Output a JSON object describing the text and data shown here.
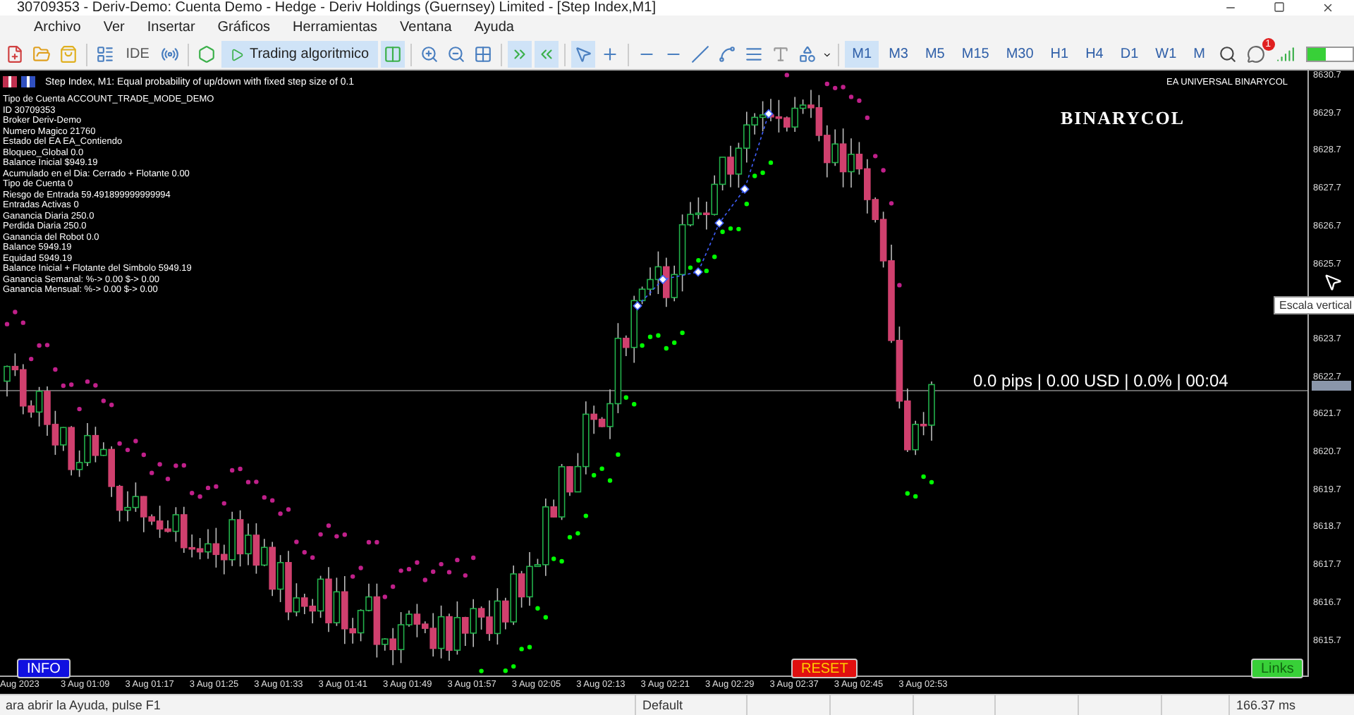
{
  "window": {
    "title": "30709353 - Deriv-Demo: Cuenta Demo - Hedge - Deriv Holdings (Guernsey) Limited - [Step Index,M1]"
  },
  "menu": [
    "Archivo",
    "Ver",
    "Insertar",
    "Gráficos",
    "Herramientas",
    "Ventana",
    "Ayuda"
  ],
  "toolbar": {
    "ide_label": "IDE",
    "algo_button": {
      "label": "Trading algoritmico",
      "on": true
    },
    "timeframes": [
      {
        "label": "M1",
        "selected": true
      },
      {
        "label": "M3",
        "selected": false
      },
      {
        "label": "M5",
        "selected": false
      },
      {
        "label": "M15",
        "selected": false
      },
      {
        "label": "M30",
        "selected": false
      },
      {
        "label": "H1",
        "selected": false
      },
      {
        "label": "H4",
        "selected": false
      },
      {
        "label": "D1",
        "selected": false
      },
      {
        "label": "W1",
        "selected": false
      },
      {
        "label": "M",
        "selected": false
      }
    ],
    "notification_count": "1"
  },
  "chart": {
    "header": "Step Index, M1:  Equal probability of up/down with fixed step size of 0.1",
    "ea_name": "EA UNIVERSAL BINARYCOL",
    "brand": "BINARYCOL",
    "info_lines": [
      "Tipo de Cuenta ACCOUNT_TRADE_MODE_DEMO",
      "ID 30709353",
      "Broker Deriv-Demo",
      "Numero Magico 21760",
      "Estado del EA EA_Contiendo",
      "Bloqueo_Global  0.0",
      "Balance Inicial $949.19",
      "Acumulado en el Dia: Cerrado + Flotante 0.00",
      "Tipo de Cuenta  0",
      "Riesgo de Entrada 59.491899999999994",
      "Entradas Activas 0",
      "Ganancia Diaria 250.0",
      "Perdida Diaria 250.0",
      "Ganancia del Robot  0.0",
      "Balance   5949.19",
      "Equidad   5949.19",
      "Balance Inicial + Flotante del Simbolo 5949.19",
      "Ganancia Semanal: %-> 0.00 $-> 0.00",
      "Ganancia Mensual: %-> 0.00 $-> 0.00"
    ],
    "position_readout": "0.0 pips | 0.00 USD | 0.0% | 00:04",
    "buttons": [
      {
        "label": "INFO",
        "kind": "info"
      },
      {
        "label": "RESET",
        "kind": "reset"
      },
      {
        "label": "Links",
        "kind": "links"
      }
    ],
    "tooltip": "Escala vertical",
    "price_axis": [
      "8630.7",
      "8629.7",
      "8628.7",
      "8627.7",
      "8626.7",
      "8625.7",
      "8623.7",
      "8622.7",
      "8621.7",
      "8620.7",
      "8619.7",
      "8618.7",
      "8617.7",
      "8616.7",
      "8615.7"
    ],
    "time_axis": [
      "Aug 2023",
      "3 Aug 01:09",
      "3 Aug 01:17",
      "3 Aug 01:25",
      "3 Aug 01:33",
      "3 Aug 01:41",
      "3 Aug 01:49",
      "3 Aug 01:57",
      "3 Aug 02:05",
      "3 Aug 02:13",
      "3 Aug 02:21",
      "3 Aug 02:29",
      "3 Aug 02:37",
      "3 Aug 02:45",
      "3 Aug 02:53"
    ]
  },
  "status_bar": {
    "help": "ara abrir la Ayuda, pulse F1",
    "profile": "Default",
    "ping": "166.37 ms"
  }
}
